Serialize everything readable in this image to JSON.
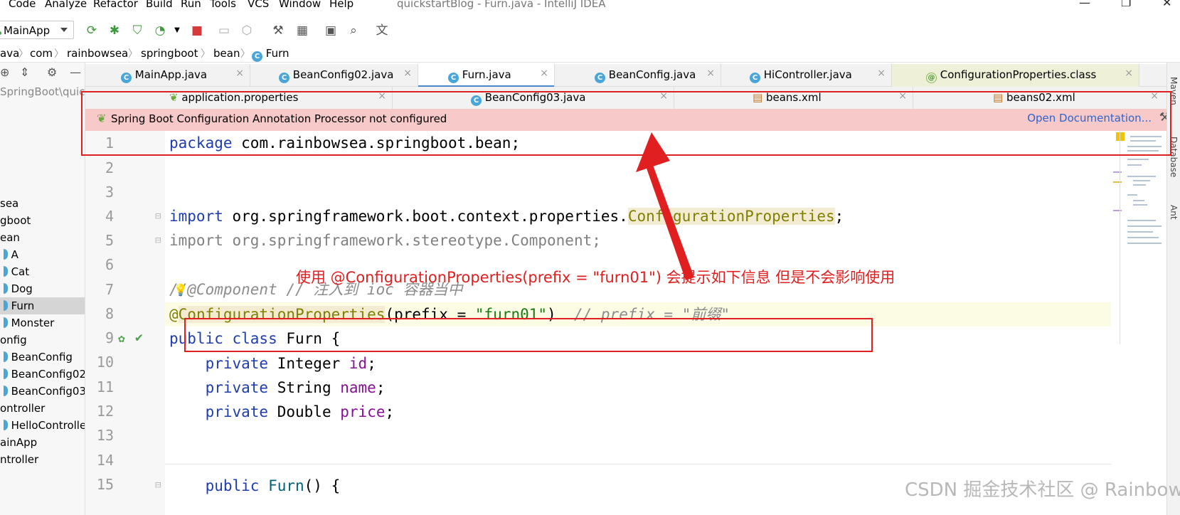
{
  "menu": {
    "items": [
      "Code",
      "Analyze",
      "Refactor",
      "Build",
      "Run",
      "Tools",
      "VCS",
      "Window",
      "Help"
    ],
    "window_title": "quickstartBlog - Furn.java - IntelliJ IDEA"
  },
  "toolbar": {
    "run_config": "MainApp"
  },
  "breadcrumb": [
    "ava",
    "com",
    "rainbowsea",
    "springboot",
    "bean",
    "Furn"
  ],
  "project": {
    "path": "SpringBoot\\quick",
    "nodes": [
      "sea",
      "gboot",
      "ean",
      "A",
      "Cat",
      "Dog",
      "Furn",
      "Monster",
      "onfig",
      "BeanConfig",
      "BeanConfig02",
      "BeanConfig03",
      "ontroller",
      "HelloController",
      "ainApp",
      "ntroller"
    ],
    "selected": "Furn"
  },
  "tabs_row1": [
    {
      "label": "MainApp.java"
    },
    {
      "label": "BeanConfig02.java"
    },
    {
      "label": "Furn.java",
      "active": true
    },
    {
      "label": "BeanConfig.java"
    },
    {
      "label": "HiController.java"
    },
    {
      "label": "ConfigurationProperties.class"
    }
  ],
  "tabs_row2": [
    {
      "label": "application.properties"
    },
    {
      "label": "BeanConfig03.java"
    },
    {
      "label": "beans.xml"
    },
    {
      "label": "beans02.xml"
    }
  ],
  "tab_close_glyph": "×",
  "banner": {
    "message": "Spring Boot Configuration Annotation Processor not configured",
    "link": "Open Documentation..."
  },
  "code": {
    "line_numbers": [
      "1",
      "2",
      "3",
      "4",
      "5",
      "6",
      "7",
      "8",
      "9",
      "10",
      "11",
      "12",
      "13",
      "14",
      "15"
    ],
    "l1_kw": "package",
    "l1_rest": " com.rainbowsea.springboot.bean;",
    "l4_kw": "import",
    "l4_pkg": " org.springframework.boot.context.properties.",
    "l4_cls": "ConfigurationProperties",
    "l4_end": ";",
    "l5_kw": "import",
    "l5_rest": " org.springframework.stereotype.Component;",
    "l7_cmt": "//@Component // 注入到 ioc 容器当中",
    "l8_at": "@",
    "l8_ann": "ConfigurationProperties",
    "l8_mid": "(prefix = ",
    "l8_str": "\"furn01\"",
    "l8_close": ")  ",
    "l8_cmt": "// prefix = \"前缀\"",
    "l9_kw": "public class",
    "l9_rest": " Furn {",
    "l10_kw": "private",
    "l10_type": " Integer ",
    "l10_fld": "id",
    "l11_kw": "private",
    "l11_type": " String ",
    "l11_fld": "name",
    "l12_kw": "private",
    "l12_type": " Double ",
    "l12_fld": "price",
    "semicolon": ";",
    "l15_kw": "public",
    "l15_mth": " Furn",
    "l15_rest": "() {"
  },
  "annotation_note": "使用 @ConfigurationProperties(prefix = \"furn01\") 会提示如下信息 但是不会影响使用",
  "right_toolbar": [
    "Maven",
    "Database",
    "Ant"
  ],
  "watermark": "CSDN 掘金技术社区 @ RainbowSea",
  "colors": {
    "annotation_red": "#e02020",
    "banner_bg": "#f7c9c9",
    "keyword": "#1f3dae",
    "string": "#1b7a14",
    "field": "#871094",
    "link": "#2f65ca"
  }
}
